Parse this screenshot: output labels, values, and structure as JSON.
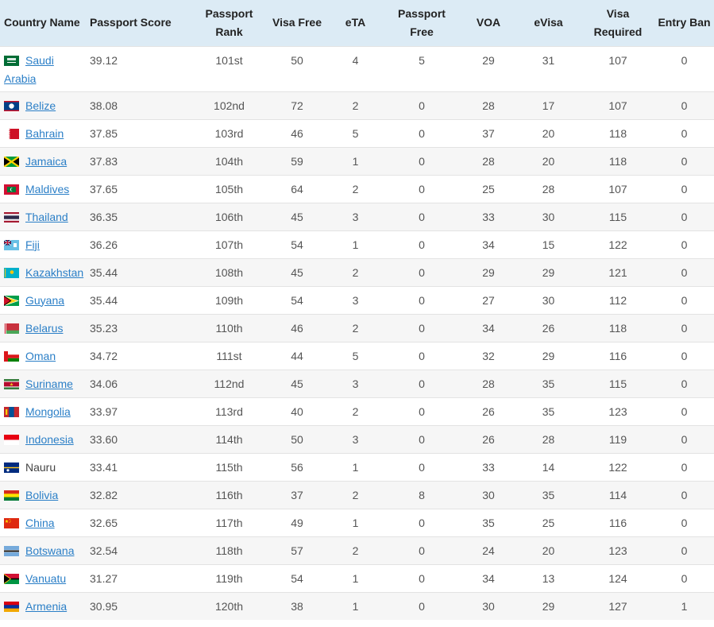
{
  "table": {
    "headers": {
      "country": "Country Name",
      "score": "Passport Score",
      "rank": [
        "Passport",
        "Rank"
      ],
      "visa_free": "Visa Free",
      "eta": "eTA",
      "passport_free": [
        "Passport",
        "Free"
      ],
      "voa": "VOA",
      "evisa": "eVisa",
      "visa_required": [
        "Visa",
        "Required"
      ],
      "entry_ban": "Entry Ban"
    },
    "rows": [
      {
        "country": "Saudi Arabia",
        "flag": "saudi-arabia-flag-icon",
        "link": true,
        "score": "39.12",
        "rank": "101st",
        "visa_free": "50",
        "eta": "4",
        "passport_free": "5",
        "voa": "29",
        "evisa": "31",
        "visa_required": "107",
        "entry_ban": "0"
      },
      {
        "country": "Belize",
        "flag": "belize-flag-icon",
        "link": true,
        "score": "38.08",
        "rank": "102nd",
        "visa_free": "72",
        "eta": "2",
        "passport_free": "0",
        "voa": "28",
        "evisa": "17",
        "visa_required": "107",
        "entry_ban": "0"
      },
      {
        "country": "Bahrain",
        "flag": "bahrain-flag-icon",
        "link": true,
        "score": "37.85",
        "rank": "103rd",
        "visa_free": "46",
        "eta": "5",
        "passport_free": "0",
        "voa": "37",
        "evisa": "20",
        "visa_required": "118",
        "entry_ban": "0"
      },
      {
        "country": "Jamaica",
        "flag": "jamaica-flag-icon",
        "link": true,
        "score": "37.83",
        "rank": "104th",
        "visa_free": "59",
        "eta": "1",
        "passport_free": "0",
        "voa": "28",
        "evisa": "20",
        "visa_required": "118",
        "entry_ban": "0"
      },
      {
        "country": "Maldives",
        "flag": "maldives-flag-icon",
        "link": true,
        "score": "37.65",
        "rank": "105th",
        "visa_free": "64",
        "eta": "2",
        "passport_free": "0",
        "voa": "25",
        "evisa": "28",
        "visa_required": "107",
        "entry_ban": "0"
      },
      {
        "country": "Thailand",
        "flag": "thailand-flag-icon",
        "link": true,
        "score": "36.35",
        "rank": "106th",
        "visa_free": "45",
        "eta": "3",
        "passport_free": "0",
        "voa": "33",
        "evisa": "30",
        "visa_required": "115",
        "entry_ban": "0"
      },
      {
        "country": "Fiji",
        "flag": "fiji-flag-icon",
        "link": true,
        "score": "36.26",
        "rank": "107th",
        "visa_free": "54",
        "eta": "1",
        "passport_free": "0",
        "voa": "34",
        "evisa": "15",
        "visa_required": "122",
        "entry_ban": "0"
      },
      {
        "country": "Kazakhstan",
        "flag": "kazakhstan-flag-icon",
        "link": true,
        "score": "35.44",
        "rank": "108th",
        "visa_free": "45",
        "eta": "2",
        "passport_free": "0",
        "voa": "29",
        "evisa": "29",
        "visa_required": "121",
        "entry_ban": "0"
      },
      {
        "country": "Guyana",
        "flag": "guyana-flag-icon",
        "link": true,
        "score": "35.44",
        "rank": "109th",
        "visa_free": "54",
        "eta": "3",
        "passport_free": "0",
        "voa": "27",
        "evisa": "30",
        "visa_required": "112",
        "entry_ban": "0"
      },
      {
        "country": "Belarus",
        "flag": "belarus-flag-icon",
        "link": true,
        "score": "35.23",
        "rank": "110th",
        "visa_free": "46",
        "eta": "2",
        "passport_free": "0",
        "voa": "34",
        "evisa": "26",
        "visa_required": "118",
        "entry_ban": "0"
      },
      {
        "country": "Oman",
        "flag": "oman-flag-icon",
        "link": true,
        "score": "34.72",
        "rank": "111st",
        "visa_free": "44",
        "eta": "5",
        "passport_free": "0",
        "voa": "32",
        "evisa": "29",
        "visa_required": "116",
        "entry_ban": "0"
      },
      {
        "country": "Suriname",
        "flag": "suriname-flag-icon",
        "link": true,
        "score": "34.06",
        "rank": "112nd",
        "visa_free": "45",
        "eta": "3",
        "passport_free": "0",
        "voa": "28",
        "evisa": "35",
        "visa_required": "115",
        "entry_ban": "0"
      },
      {
        "country": "Mongolia",
        "flag": "mongolia-flag-icon",
        "link": true,
        "score": "33.97",
        "rank": "113rd",
        "visa_free": "40",
        "eta": "2",
        "passport_free": "0",
        "voa": "26",
        "evisa": "35",
        "visa_required": "123",
        "entry_ban": "0"
      },
      {
        "country": "Indonesia",
        "flag": "indonesia-flag-icon",
        "link": true,
        "score": "33.60",
        "rank": "114th",
        "visa_free": "50",
        "eta": "3",
        "passport_free": "0",
        "voa": "26",
        "evisa": "28",
        "visa_required": "119",
        "entry_ban": "0"
      },
      {
        "country": "Nauru",
        "flag": "nauru-flag-icon",
        "link": false,
        "score": "33.41",
        "rank": "115th",
        "visa_free": "56",
        "eta": "1",
        "passport_free": "0",
        "voa": "33",
        "evisa": "14",
        "visa_required": "122",
        "entry_ban": "0"
      },
      {
        "country": "Bolivia",
        "flag": "bolivia-flag-icon",
        "link": true,
        "score": "32.82",
        "rank": "116th",
        "visa_free": "37",
        "eta": "2",
        "passport_free": "8",
        "voa": "30",
        "evisa": "35",
        "visa_required": "114",
        "entry_ban": "0"
      },
      {
        "country": "China",
        "flag": "china-flag-icon",
        "link": true,
        "score": "32.65",
        "rank": "117th",
        "visa_free": "49",
        "eta": "1",
        "passport_free": "0",
        "voa": "35",
        "evisa": "25",
        "visa_required": "116",
        "entry_ban": "0"
      },
      {
        "country": "Botswana",
        "flag": "botswana-flag-icon",
        "link": true,
        "score": "32.54",
        "rank": "118th",
        "visa_free": "57",
        "eta": "2",
        "passport_free": "0",
        "voa": "24",
        "evisa": "20",
        "visa_required": "123",
        "entry_ban": "0"
      },
      {
        "country": "Vanuatu",
        "flag": "vanuatu-flag-icon",
        "link": true,
        "score": "31.27",
        "rank": "119th",
        "visa_free": "54",
        "eta": "1",
        "passport_free": "0",
        "voa": "34",
        "evisa": "13",
        "visa_required": "124",
        "entry_ban": "0"
      },
      {
        "country": "Armenia",
        "flag": "armenia-flag-icon",
        "link": true,
        "score": "30.95",
        "rank": "120th",
        "visa_free": "38",
        "eta": "1",
        "passport_free": "0",
        "voa": "30",
        "evisa": "29",
        "visa_required": "127",
        "entry_ban": "1"
      }
    ]
  },
  "colors": {
    "header_bg": "#dcebf5",
    "link": "#2b7fc7",
    "stripe": "#f6f6f6",
    "text": "#555555"
  }
}
